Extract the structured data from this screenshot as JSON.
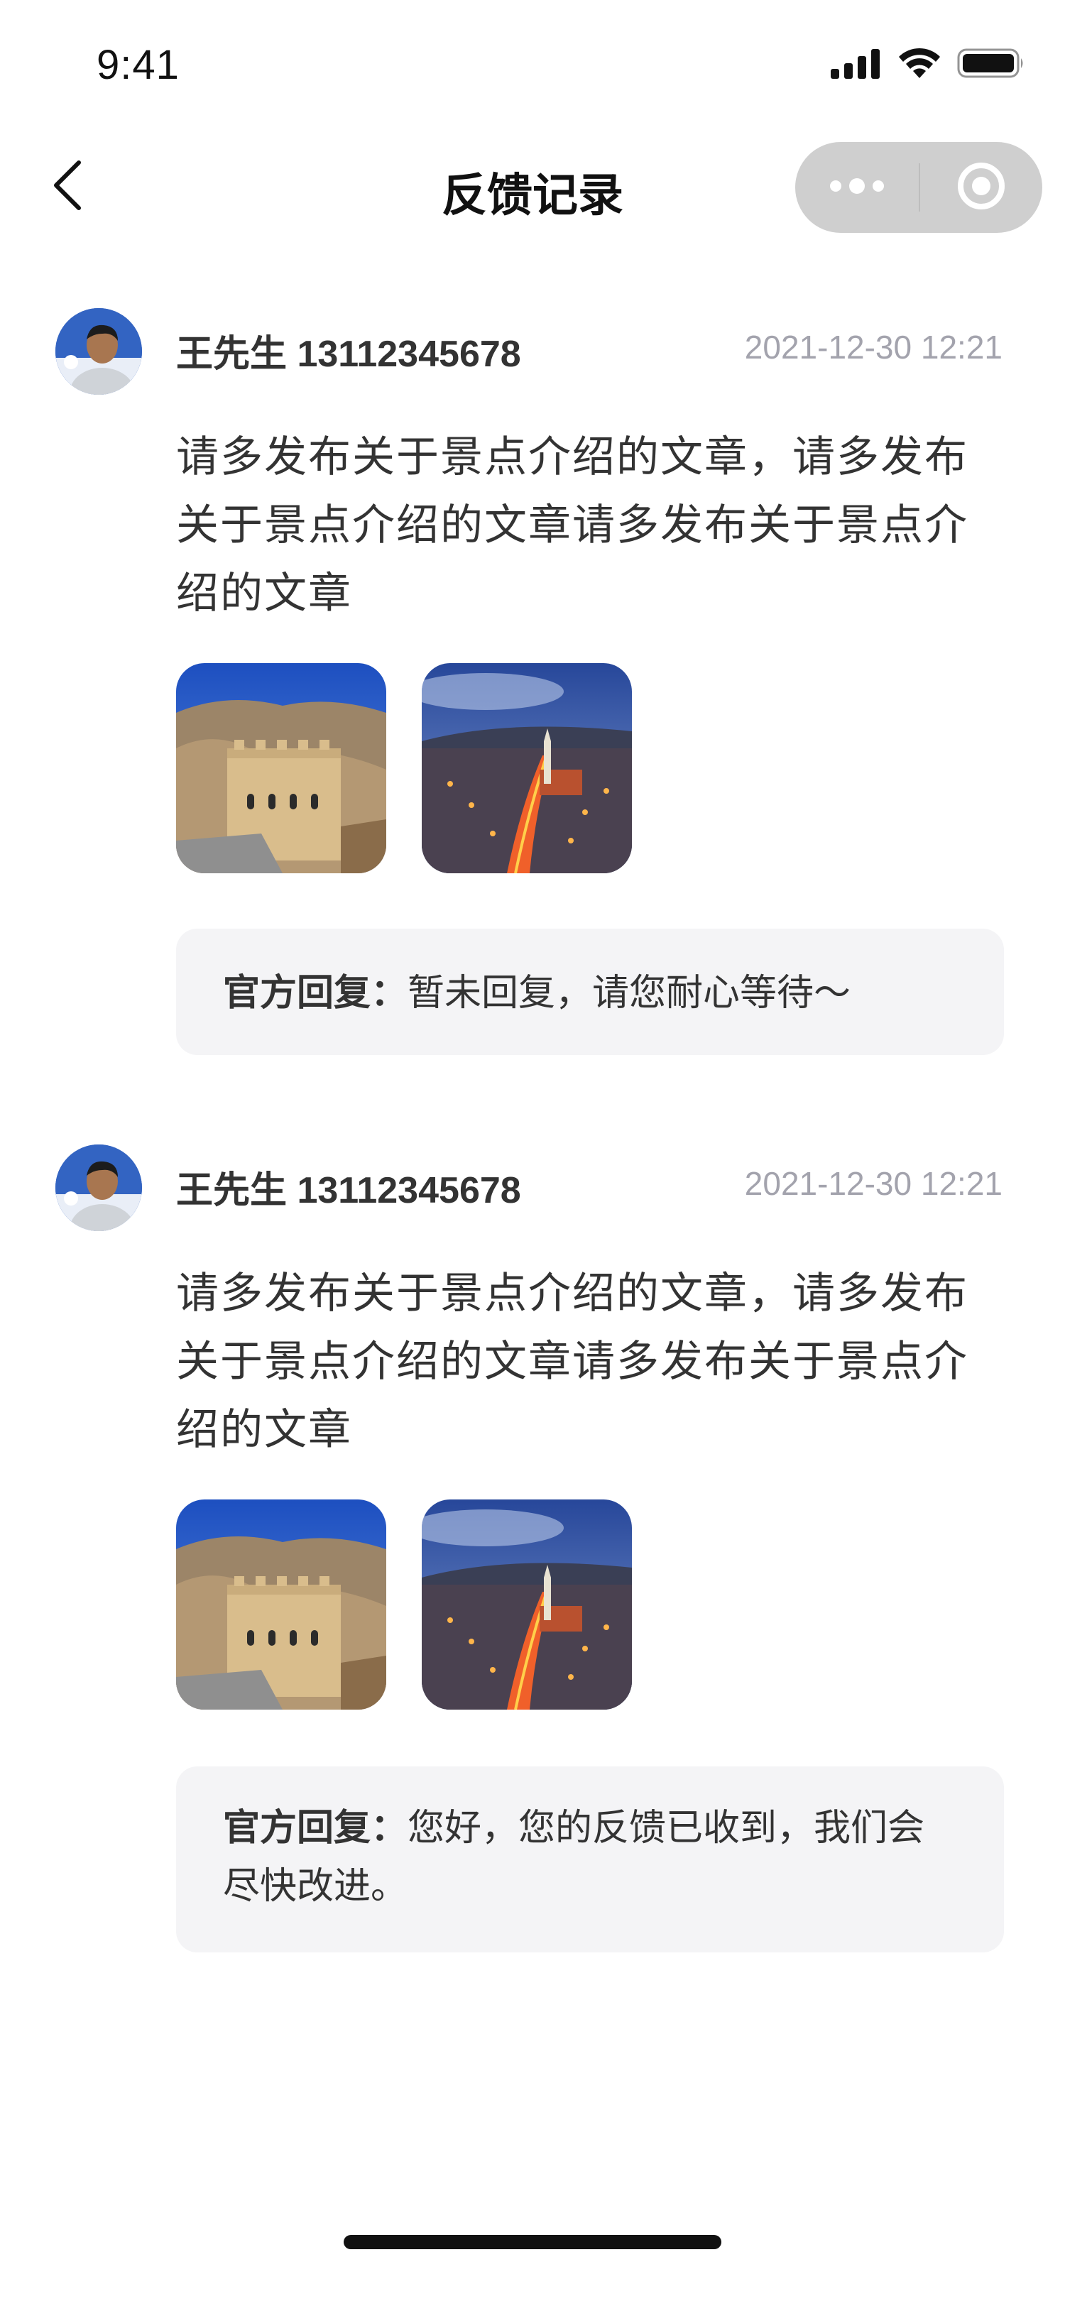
{
  "status_bar": {
    "time": "9:41",
    "icons": [
      "cellular-signal-icon",
      "wifi-icon",
      "battery-icon"
    ]
  },
  "nav": {
    "title": "反馈记录",
    "back_icon": "chevron-left-icon",
    "capsule_icons": [
      "more-dots-icon",
      "close-target-icon"
    ]
  },
  "feedback": [
    {
      "user": "王先生 13112345678",
      "time": "2021-12-30 12:21",
      "content": "请多发布关于景点介绍的文章，请多发布关于景点介绍的文章请多发布关于景点介绍的文章",
      "images": [
        "great-wall-photo",
        "city-night-photo"
      ],
      "reply_label": "官方回复：",
      "reply_text": "暂未回复，请您耐心等待～"
    },
    {
      "user": "王先生 13112345678",
      "time": "2021-12-30 12:21",
      "content": "请多发布关于景点介绍的文章，请多发布关于景点介绍的文章请多发布关于景点介绍的文章",
      "images": [
        "great-wall-photo",
        "city-night-photo"
      ],
      "reply_label": "官方回复：",
      "reply_text": "您好，您的反馈已收到，我们会尽快改进。"
    }
  ],
  "colors": {
    "text_primary": "#333333",
    "text_muted": "#a3a3ad",
    "reply_bg": "#f4f4f6",
    "capsule_bg": "#cfcfcf"
  }
}
